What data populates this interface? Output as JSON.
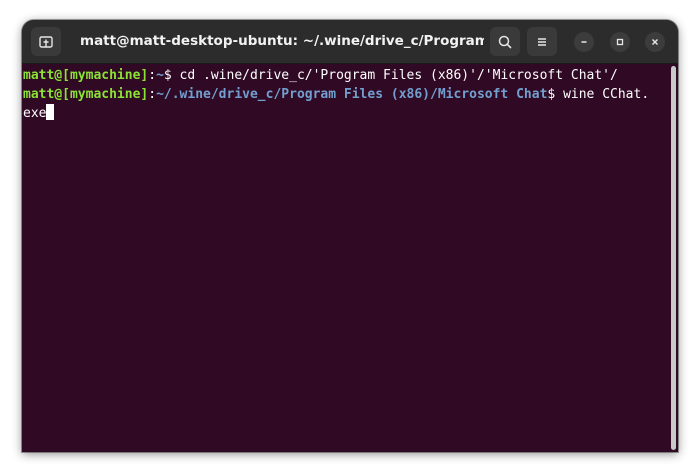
{
  "window": {
    "title": "matt@matt-desktop-ubuntu: ~/.wine/drive_c/Program Files (..."
  },
  "titlebar": {
    "icons": [
      "new-tab-icon",
      "search-icon",
      "hamburger-menu-icon",
      "minimize-icon",
      "maximize-icon",
      "close-icon"
    ]
  },
  "terminal": {
    "lines": [
      {
        "user": "matt@[mymachine]",
        "colon": ":",
        "path": "~",
        "prompt": "$ ",
        "command": "cd .wine/drive_c/'Program Files (x86)'/'Microsoft Chat'/"
      },
      {
        "user": "matt@[mymachine]",
        "colon": ":",
        "path": "~/.wine/drive_c/Program Files (x86)/Microsoft Chat",
        "prompt": "$ ",
        "command": "wine CChat.",
        "continuation": "exe"
      }
    ]
  },
  "colors": {
    "terminal_background": "#300a24",
    "prompt_user": "#8ae234",
    "prompt_path": "#729fcf",
    "titlebar": "#2c2c2c"
  }
}
